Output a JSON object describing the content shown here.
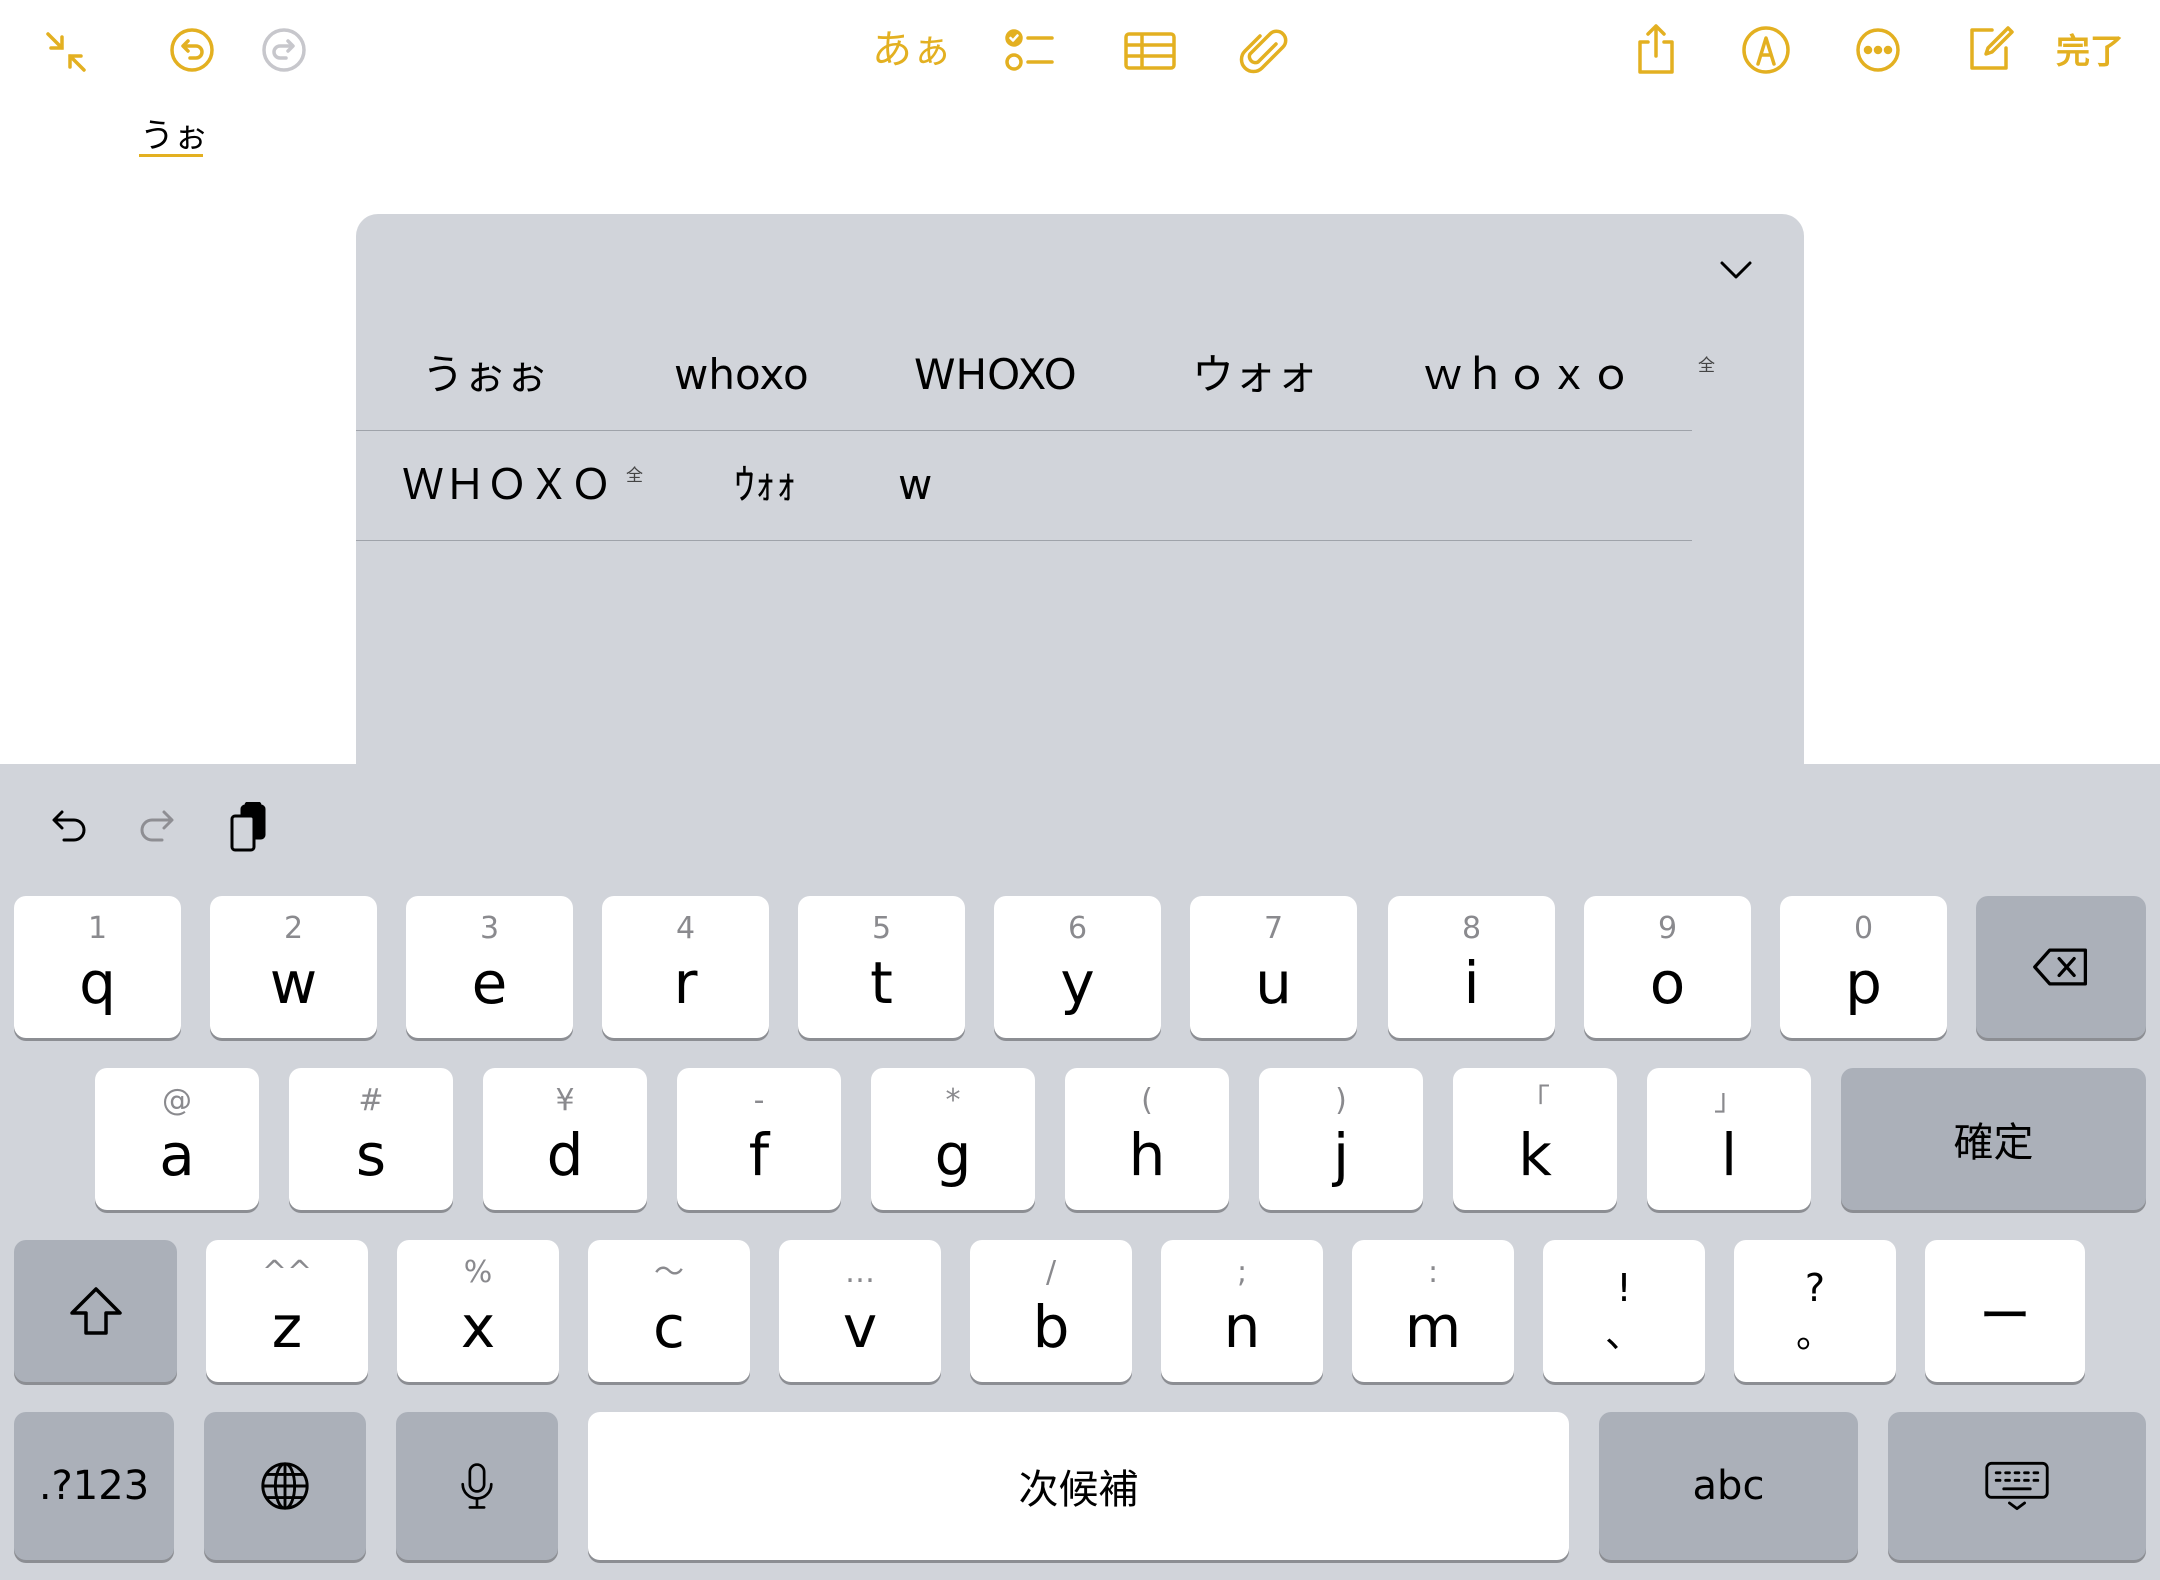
{
  "toolbar": {
    "format_label": "あぁ",
    "done_label": "完了",
    "accent_color": "#e3b021"
  },
  "note": {
    "composing_text": "うぉ"
  },
  "candidates": {
    "row1": [
      "うぉぉ",
      "whoxo",
      "WHOXO",
      "ウォォ",
      "ｗｈｏｘｏ"
    ],
    "row1_zen_badge": "全",
    "row2": [
      "ＷＨＯＸＯ",
      "ｳｫｫ",
      "w"
    ],
    "row2_zen_badge": "全"
  },
  "keyboard": {
    "row1": [
      {
        "hint": "1",
        "key": "q"
      },
      {
        "hint": "2",
        "key": "w"
      },
      {
        "hint": "3",
        "key": "e"
      },
      {
        "hint": "4",
        "key": "r"
      },
      {
        "hint": "5",
        "key": "t"
      },
      {
        "hint": "6",
        "key": "y"
      },
      {
        "hint": "7",
        "key": "u"
      },
      {
        "hint": "8",
        "key": "i"
      },
      {
        "hint": "9",
        "key": "o"
      },
      {
        "hint": "0",
        "key": "p"
      }
    ],
    "row2": [
      {
        "hint": "@",
        "key": "a"
      },
      {
        "hint": "#",
        "key": "s"
      },
      {
        "hint": "¥",
        "key": "d"
      },
      {
        "hint": "-",
        "key": "f"
      },
      {
        "hint": "*",
        "key": "g"
      },
      {
        "hint": "(",
        "key": "h"
      },
      {
        "hint": ")",
        "key": "j"
      },
      {
        "hint": "「",
        "key": "k"
      },
      {
        "hint": "」",
        "key": "l"
      }
    ],
    "confirm_label": "確定",
    "row3": [
      {
        "hint": "^^",
        "key": "z"
      },
      {
        "hint": "%",
        "key": "x"
      },
      {
        "hint": "〜",
        "key": "c"
      },
      {
        "hint": "…",
        "key": "v"
      },
      {
        "hint": "/",
        "key": "b"
      },
      {
        "hint": ";",
        "key": "n"
      },
      {
        "hint": ":",
        "key": "m"
      }
    ],
    "punct1": {
      "top": "!",
      "bottom": "、"
    },
    "punct2": {
      "top": "?",
      "bottom": "。"
    },
    "dash_label": "ー",
    "numbers_label": ".?123",
    "space_label": "次候補",
    "abc_label": "abc"
  }
}
